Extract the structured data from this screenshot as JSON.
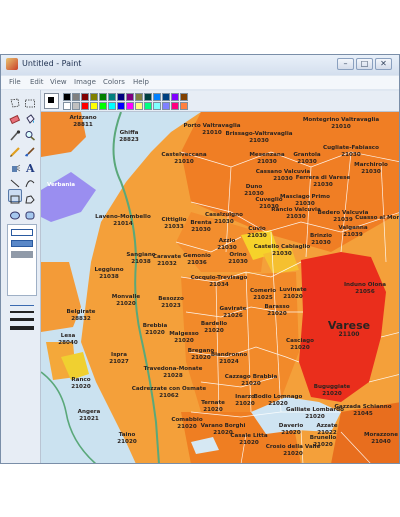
{
  "window": {
    "title": "Untitled - Paint",
    "controls": {
      "minimize": "–",
      "maximize": "□",
      "close": "✕"
    }
  },
  "menu": [
    "File",
    "Edit",
    "View",
    "Image",
    "Colors",
    "Help"
  ],
  "palette_colors": [
    "#000000",
    "#808080",
    "#800000",
    "#808000",
    "#008000",
    "#008080",
    "#000080",
    "#800080",
    "#808040",
    "#004040",
    "#0080ff",
    "#004080",
    "#8000ff",
    "#804000",
    "#ffffff",
    "#c0c0c0",
    "#ff0000",
    "#ffff00",
    "#00ff00",
    "#00ffff",
    "#0000ff",
    "#ff00ff",
    "#ffff80",
    "#00ff80",
    "#80ffff",
    "#8080ff",
    "#ff0080",
    "#ff8040"
  ],
  "tools": [
    "free-select-icon",
    "rect-select-icon",
    "eraser-icon",
    "fill-icon",
    "color-picker-icon",
    "magnifier-icon",
    "pencil-icon",
    "brush-icon",
    "airbrush-icon",
    "text-icon",
    "line-icon",
    "curve-icon",
    "rectangle-icon",
    "polygon-icon",
    "ellipse-icon",
    "rounded-rect-icon"
  ],
  "map": {
    "labels": [
      {
        "name": "Ispra",
        "cap": "",
        "code": "",
        "big": false
      },
      {
        "name": "Ispra",
        "cap": "21027",
        "code": "",
        "big": false
      }
    ],
    "places": [
      {
        "n": "Biandronno",
        "c": "21024"
      },
      {
        "n": "Varese",
        "c": "21100"
      }
    ],
    "items": [
      {
        "n": "Arizzano",
        "c": "28811"
      },
      {
        "n": "Ghiffa",
        "c": "28823"
      },
      {
        "n": "Porto Valtravaglia",
        "c": "21010"
      },
      {
        "n": "Brissago-Valtravaglia",
        "c": "21030"
      },
      {
        "n": "Montegrino Valtravaglia",
        "c": "21010"
      },
      {
        "n": "Castelveccana",
        "c": "21010"
      },
      {
        "n": "Mesenzana",
        "c": "21030"
      },
      {
        "n": "Grantola",
        "c": "21030"
      },
      {
        "n": "Cugliate-Fabiasco",
        "c": "21030"
      },
      {
        "n": "Cassano Valcuvia",
        "c": "21030"
      },
      {
        "n": "Ferrera di Varese",
        "c": "21030"
      },
      {
        "n": "Marchirolo",
        "c": "21030"
      },
      {
        "n": "Duno",
        "c": "21030"
      },
      {
        "n": "Cuveglio",
        "c": "21030"
      },
      {
        "n": "Masciago Primo",
        "c": "21030"
      },
      {
        "n": "Rancio Valcuvia",
        "c": "21030"
      },
      {
        "n": "Bedero Valcuvia",
        "c": "21039"
      },
      {
        "n": "Valganna",
        "c": "21039"
      },
      {
        "n": "Cuasso al Monte",
        "c": ""
      },
      {
        "n": "Laveno-Mombello",
        "c": "21014"
      },
      {
        "n": "Cittiglio",
        "c": "21033"
      },
      {
        "n": "Brenta",
        "c": "21030"
      },
      {
        "n": "Casalzuigno",
        "c": "21030"
      },
      {
        "n": "Cuvio",
        "c": "21030"
      },
      {
        "n": "Brinzio",
        "c": "21030"
      },
      {
        "n": "Azzio",
        "c": "21030"
      },
      {
        "n": "Orino",
        "c": "21030"
      },
      {
        "n": "Castello Cabiaglio",
        "c": "21030"
      },
      {
        "n": "Sangiano",
        "c": "21038"
      },
      {
        "n": "Caravate",
        "c": "21032"
      },
      {
        "n": "Gemonio",
        "c": "21036"
      },
      {
        "n": "Induno Olona",
        "c": "21056"
      },
      {
        "n": "Leggiuno",
        "c": "21038"
      },
      {
        "n": "Cocquio-Trevisago",
        "c": "21034"
      },
      {
        "n": "Comerio",
        "c": "21025"
      },
      {
        "n": "Luvinate",
        "c": "21020"
      },
      {
        "n": "Barasso",
        "c": "21020"
      },
      {
        "n": "Monvalle",
        "c": "21020"
      },
      {
        "n": "Besozzo",
        "c": "21023"
      },
      {
        "n": "Gavirate",
        "c": "21026"
      },
      {
        "n": "Belgirate",
        "c": "28832"
      },
      {
        "n": "Lesa",
        "c": "28040"
      },
      {
        "n": "Brebbia",
        "c": "21020"
      },
      {
        "n": "Malgesso",
        "c": "21020"
      },
      {
        "n": "Bardello",
        "c": "21020"
      },
      {
        "n": "Casciago",
        "c": "21020"
      },
      {
        "n": "Bregano",
        "c": "21020"
      },
      {
        "n": "Travedona-Monate",
        "c": "21028"
      },
      {
        "n": "Cazzago Brabbia",
        "c": "21020"
      },
      {
        "n": "Buguggiate",
        "c": "21020"
      },
      {
        "n": "Cadrezzate con Osmate",
        "c": "21062"
      },
      {
        "n": "Gazzada Schianno",
        "c": "21045"
      },
      {
        "n": "Ternate",
        "c": "21020"
      },
      {
        "n": "Inarzo",
        "c": "21020"
      },
      {
        "n": "Bodio Lomnago",
        "c": "21020"
      },
      {
        "n": "Comabbio",
        "c": "21020"
      },
      {
        "n": "Varano Borghi",
        "c": "21020"
      },
      {
        "n": "Casale Litta",
        "c": "21020"
      },
      {
        "n": "Daverio",
        "c": "21020"
      },
      {
        "n": "Galliate Lombardo",
        "c": "21020"
      },
      {
        "n": "Azzate",
        "c": "21022"
      },
      {
        "n": "Brunello",
        "c": "21020"
      },
      {
        "n": "Crosio della Valle",
        "c": "21020"
      },
      {
        "n": "Morazzone",
        "c": "21040"
      },
      {
        "n": "Angera",
        "c": "21021"
      },
      {
        "n": "Taino",
        "c": "21020"
      },
      {
        "n": "Ranco",
        "c": "21020"
      },
      {
        "n": "Verbania",
        "c": ""
      },
      {
        "n": "Ispra",
        "c": "21027"
      }
    ]
  }
}
